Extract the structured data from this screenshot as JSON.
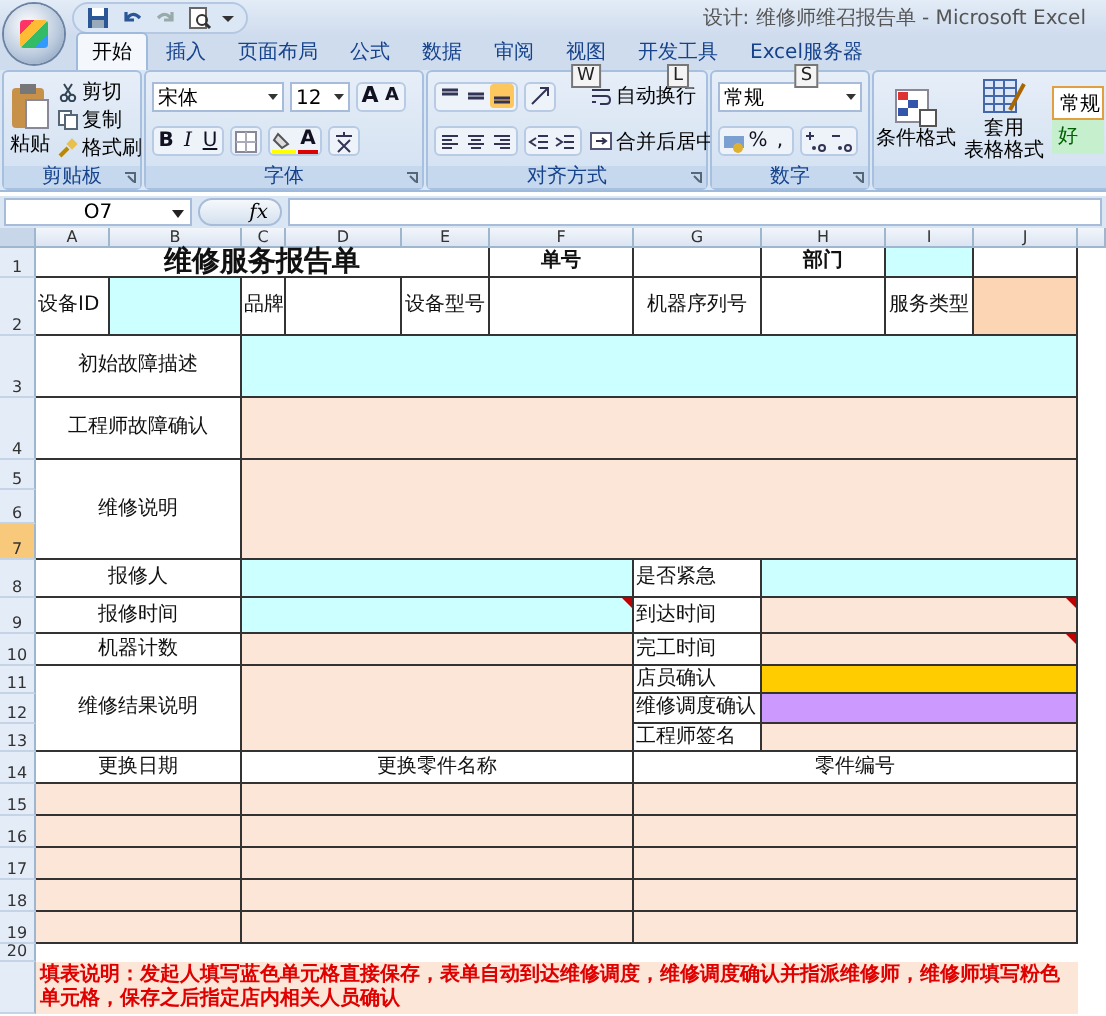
{
  "title_bar": {
    "title": "设计: 维修师维召报告单 - Microsoft Excel"
  },
  "tabs": [
    {
      "label": "开始",
      "selected": true
    },
    {
      "label": "插入",
      "selected": false
    },
    {
      "label": "页面布局",
      "selected": false
    },
    {
      "label": "公式",
      "selected": false
    },
    {
      "label": "数据",
      "selected": false
    },
    {
      "label": "审阅",
      "selected": false
    },
    {
      "label": "视图",
      "selected": false,
      "keytip": "W"
    },
    {
      "label": "开发工具",
      "selected": false,
      "keytip": "L"
    },
    {
      "label": "Excel服务器",
      "selected": false,
      "keytip": "S"
    }
  ],
  "ribbon": {
    "clipboard": {
      "label": "剪贴板",
      "paste": "粘贴",
      "tools": [
        "剪切",
        "复制",
        "格式刷"
      ]
    },
    "font": {
      "label": "字体",
      "name": "宋体",
      "size": "12",
      "size_buttons": [
        "A",
        "A"
      ],
      "styles": [
        "B",
        "I",
        "U"
      ],
      "color_letter": "A"
    },
    "alignment": {
      "label": "对齐方式",
      "wrap": "自动换行",
      "merge": "合并后居中"
    },
    "number": {
      "label": "数字",
      "format": "常规",
      "symbols": [
        "%",
        ","
      ]
    },
    "styles": {
      "conditional": "条件格式",
      "table": [
        "套用",
        "表格格式"
      ],
      "normal": "常规",
      "good": "好"
    }
  },
  "formula_bar": {
    "name_box": "O7",
    "fx": "fx"
  },
  "sheet": {
    "columns": [
      "A",
      "B",
      "C",
      "D",
      "E",
      "F",
      "G",
      "H",
      "I",
      "J"
    ],
    "rows": [
      {
        "label": "1",
        "selected": false
      },
      {
        "label": "2",
        "selected": false
      },
      {
        "label": "3",
        "selected": false
      },
      {
        "label": "4",
        "selected": false
      },
      {
        "label": "5",
        "selected": false
      },
      {
        "label": "6",
        "selected": false
      },
      {
        "label": "7",
        "selected": true
      },
      {
        "label": "8",
        "selected": false
      },
      {
        "label": "9",
        "selected": false
      },
      {
        "label": "10",
        "selected": false
      },
      {
        "label": "11",
        "selected": false
      },
      {
        "label": "12",
        "selected": false
      },
      {
        "label": "13",
        "selected": false
      },
      {
        "label": "14",
        "selected": false
      },
      {
        "label": "15",
        "selected": false
      },
      {
        "label": "16",
        "selected": false
      },
      {
        "label": "17",
        "selected": false
      },
      {
        "label": "18",
        "selected": false
      },
      {
        "label": "19",
        "selected": false
      },
      {
        "label": "20",
        "selected": false
      }
    ],
    "cells": [
      {
        "kind": "title",
        "text": "维修服务报告单",
        "color": "#ffffff",
        "comment": false
      },
      {
        "kind": "header",
        "text": "单号",
        "color": "#ffffff",
        "comment": false
      },
      {
        "kind": "field",
        "color": "#ffffff",
        "comment": false
      },
      {
        "kind": "header",
        "text": "部门",
        "color": "#ffffff",
        "comment": false
      },
      {
        "kind": "field",
        "color": "#ccffff",
        "comment": false
      },
      {
        "kind": "field",
        "color": "#ffffff",
        "comment": false
      },
      {
        "kind": "label-left",
        "text": "设备ID",
        "color": "#ffffff",
        "comment": false
      },
      {
        "kind": "field",
        "color": "#ccffff",
        "comment": false
      },
      {
        "kind": "label-left",
        "text": "品牌",
        "color": "#ffffff",
        "comment": false
      },
      {
        "kind": "field",
        "color": "#ffffff",
        "comment": false
      },
      {
        "kind": "label",
        "text": "设备型号",
        "color": "#ffffff",
        "comment": false
      },
      {
        "kind": "field",
        "color": "#ffffff",
        "comment": false
      },
      {
        "kind": "label",
        "text": "机器序列号",
        "color": "#ffffff",
        "comment": false
      },
      {
        "kind": "field",
        "color": "#ffffff",
        "comment": false
      },
      {
        "kind": "label",
        "text": "服务类型",
        "color": "#ffffff",
        "comment": false
      },
      {
        "kind": "field",
        "color": "#fcd5b4",
        "comment": false
      },
      {
        "kind": "label",
        "text": "初始故障描述",
        "color": "#ffffff",
        "comment": false
      },
      {
        "kind": "field",
        "color": "#ccffff",
        "comment": false
      },
      {
        "kind": "label",
        "text": "工程师故障确认",
        "color": "#ffffff",
        "comment": false
      },
      {
        "kind": "field",
        "color": "#fbe6d8",
        "comment": false
      },
      {
        "kind": "label",
        "text": "维修说明",
        "color": "#ffffff",
        "comment": false
      },
      {
        "kind": "field",
        "color": "#fbe6d8",
        "comment": false
      },
      {
        "kind": "label",
        "text": "报修人",
        "color": "#ffffff",
        "comment": false
      },
      {
        "kind": "field",
        "color": "#ccffff",
        "comment": false
      },
      {
        "kind": "label-left",
        "text": "是否紧急",
        "color": "#ffffff",
        "comment": false
      },
      {
        "kind": "field",
        "color": "#ccffff",
        "comment": false
      },
      {
        "kind": "label",
        "text": "报修时间",
        "color": "#ffffff",
        "comment": false
      },
      {
        "kind": "field",
        "color": "#ccffff",
        "comment": true
      },
      {
        "kind": "label-left",
        "text": "到达时间",
        "color": "#ffffff",
        "comment": false
      },
      {
        "kind": "field",
        "color": "#fbe6d8",
        "comment": true
      },
      {
        "kind": "label",
        "text": "机器计数",
        "color": "#ffffff",
        "comment": false
      },
      {
        "kind": "field",
        "color": "#fbe6d8",
        "comment": false
      },
      {
        "kind": "label-left",
        "text": "完工时间",
        "color": "#ffffff",
        "comment": false
      },
      {
        "kind": "field",
        "color": "#fbe6d8",
        "comment": true
      },
      {
        "kind": "label",
        "text": "维修结果说明",
        "color": "#ffffff",
        "comment": false
      },
      {
        "kind": "field",
        "color": "#fbe6d8",
        "comment": false
      },
      {
        "kind": "label-left",
        "text": "店员确认",
        "color": "#ffffff",
        "comment": false
      },
      {
        "kind": "field",
        "color": "#ffcc00",
        "comment": false
      },
      {
        "kind": "label-left",
        "text": "维修调度确认",
        "color": "#ffffff",
        "comment": false
      },
      {
        "kind": "field",
        "color": "#cc99ff",
        "comment": false
      },
      {
        "kind": "label-left",
        "text": "工程师签名",
        "color": "#ffffff",
        "comment": false
      },
      {
        "kind": "field",
        "color": "#fbe6d8",
        "comment": false
      },
      {
        "kind": "label",
        "text": "更换日期",
        "color": "#ffffff",
        "comment": false
      },
      {
        "kind": "label",
        "text": "更换零件名称",
        "color": "#ffffff",
        "comment": false
      },
      {
        "kind": "label",
        "text": "零件编号",
        "color": "#ffffff",
        "comment": false
      },
      {
        "kind": "field",
        "color": "#fbe6d8",
        "comment": false
      },
      {
        "kind": "field",
        "color": "#fbe6d8",
        "comment": false
      },
      {
        "kind": "field",
        "color": "#fbe6d8",
        "comment": false
      },
      {
        "kind": "field",
        "color": "#fbe6d8",
        "comment": false
      },
      {
        "kind": "field",
        "color": "#fbe6d8",
        "comment": false
      },
      {
        "kind": "field",
        "color": "#fbe6d8",
        "comment": false
      },
      {
        "kind": "field",
        "color": "#fbe6d8",
        "comment": false
      },
      {
        "kind": "field",
        "color": "#fbe6d8",
        "comment": false
      },
      {
        "kind": "field",
        "color": "#fbe6d8",
        "comment": false
      },
      {
        "kind": "field",
        "color": "#fbe6d8",
        "comment": false
      },
      {
        "kind": "field",
        "color": "#fbe6d8",
        "comment": false
      },
      {
        "kind": "field",
        "color": "#fbe6d8",
        "comment": false
      },
      {
        "kind": "field",
        "color": "#fbe6d8",
        "comment": false
      },
      {
        "kind": "field",
        "color": "#fbe6d8",
        "comment": false
      },
      {
        "kind": "field",
        "color": "#fbe6d8",
        "comment": false
      },
      {
        "kind": "note",
        "text": "填表说明：发起人填写蓝色单元格直接保存，表单自动到达维修调度，维修调度确认并指派维修师，维修师填写粉色单元格，保存之后指定店内相关人员确认",
        "color": "#fbe6d8",
        "comment": false
      }
    ]
  }
}
